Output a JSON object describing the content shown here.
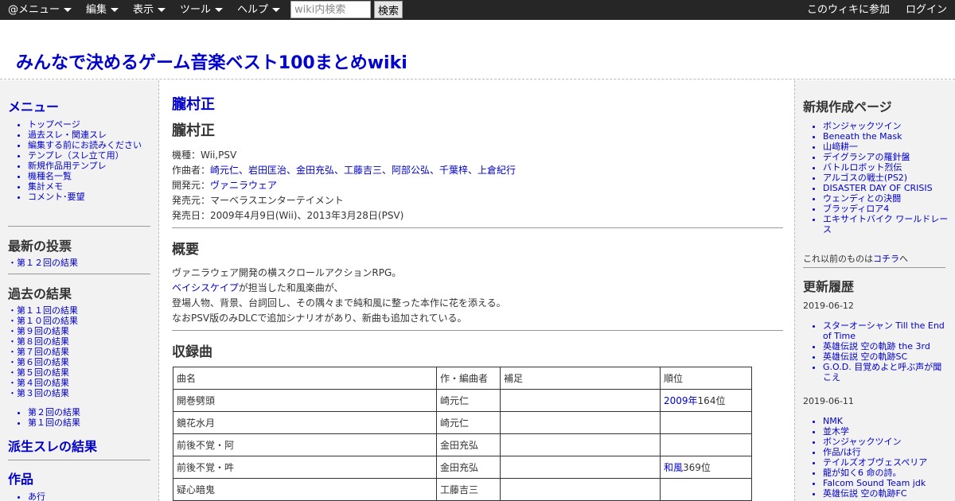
{
  "topbar": {
    "menus": [
      "@メニュー",
      "編集",
      "表示",
      "ツール",
      "ヘルプ"
    ],
    "search_placeholder": "wiki内検索",
    "search_button": "検索",
    "join_label": "このウィキに参加",
    "login_label": "ログイン"
  },
  "header": {
    "site_title": "みんなで決めるゲーム音楽ベスト100まとめwiki"
  },
  "left_sidebar": {
    "menu_heading": "メニュー",
    "menu_items": [
      "トップページ",
      "過去スレ・関連スレ",
      "編集する前にお読みください",
      "テンプレ（スレ立て用）",
      "新規作品用テンプレ",
      "機種名一覧",
      "集計メモ",
      "コメント･要望"
    ],
    "latest_vote_heading": "最新の投票",
    "latest_vote_items": [
      "第１２回の結果"
    ],
    "past_results_heading": "過去の結果",
    "past_results_items": [
      "第１１回の結果",
      "第１０回の結果",
      "第９回の結果",
      "第８回の結果",
      "第７回の結果",
      "第６回の結果",
      "第５回の結果",
      "第４回の結果",
      "第３回の結果"
    ],
    "past_results_items2": [
      "第２回の結果",
      "第１回の結果"
    ],
    "derived_heading": "派生スレの結果",
    "works_heading": "作品",
    "works_items": [
      "あ行"
    ]
  },
  "main": {
    "link_title": "朧村正",
    "page_title": "朧村正",
    "info": {
      "platform_label": "機種：",
      "platform_value": "Wii,PSV",
      "composer_label": "作曲者：",
      "composer_value": "崎元仁、岩田匡治、金田充弘、工藤吉三、阿部公弘、千葉梓、上倉紀行",
      "developer_label": "開発元：",
      "developer_value": "ヴァニラウェア",
      "publisher_label": "発売元：",
      "publisher_value": "マーベラスエンターテイメント",
      "release_label": "発売日：",
      "release_value": "2009年4月9日(Wii)、2013年3月28日(PSV)"
    },
    "overview_heading": "概要",
    "overview_line1": "ヴァニラウェア開発の横スクロールアクションRPG。",
    "overview_line2_link": "ベイシスケイプ",
    "overview_line2_rest": "が担当した和風楽曲が、",
    "overview_line3": "登場人物、背景、台詞回し、その隅々まで純和風に整った本作に花を添える。",
    "overview_line4": "なおPSV版のみDLCで追加シナリオがあり、新曲も追加されている。",
    "tracks_heading": "収録曲",
    "table_headers": [
      "曲名",
      "作・編曲者",
      "補足",
      "順位"
    ],
    "table_rows": [
      {
        "title": "開巻劈頭",
        "composer": "崎元仁",
        "note": "",
        "rank_link": "2009年",
        "rank_rest": "164位"
      },
      {
        "title": "鏡花水月",
        "composer": "崎元仁",
        "note": "",
        "rank_link": "",
        "rank_rest": ""
      },
      {
        "title": "前後不覚・阿",
        "composer": "金田充弘",
        "note": "",
        "rank_link": "",
        "rank_rest": ""
      },
      {
        "title": "前後不覚・吽",
        "composer": "金田充弘",
        "note": "",
        "rank_link": "和風",
        "rank_rest": "369位"
      },
      {
        "title": "疑心暗鬼",
        "composer": "工藤吉三",
        "note": "",
        "rank_link": "",
        "rank_rest": ""
      }
    ]
  },
  "right_sidebar": {
    "new_pages_heading": "新規作成ページ",
    "new_pages": [
      "ボンジャックツイン",
      "Beneath the Mask",
      "山﨑耕一",
      "デイグラシアの羅針盤",
      "バトルロボット烈伝",
      "アルゴスの戦士(PS2)",
      "DISASTER DAY OF CRISIS",
      "ウェンディとの決闘",
      "ブラッディロア4",
      "エキサイトバイク ワールドレース"
    ],
    "older_prefix": "これ以前のものは",
    "older_link": "コチラ",
    "older_suffix": "へ",
    "history_heading": "更新履歴",
    "date1": "2019-06-12",
    "history1": [
      "スターオーシャン Till the End of Time",
      "英雄伝説 空の軌跡 the 3rd",
      "英雄伝説 空の軌跡SC",
      "G.O.D. 目覚めよと呼ぶ声が聞こえ"
    ],
    "date2": "2019-06-11",
    "history2": [
      "NMK",
      "並木学",
      "ボンジャックツイン",
      "作品/は行",
      "テイルズオブヴェスペリア",
      "龍が如く6 命の詩。",
      "Falcom Sound Team jdk",
      "英雄伝説 空の軌跡FC"
    ]
  }
}
